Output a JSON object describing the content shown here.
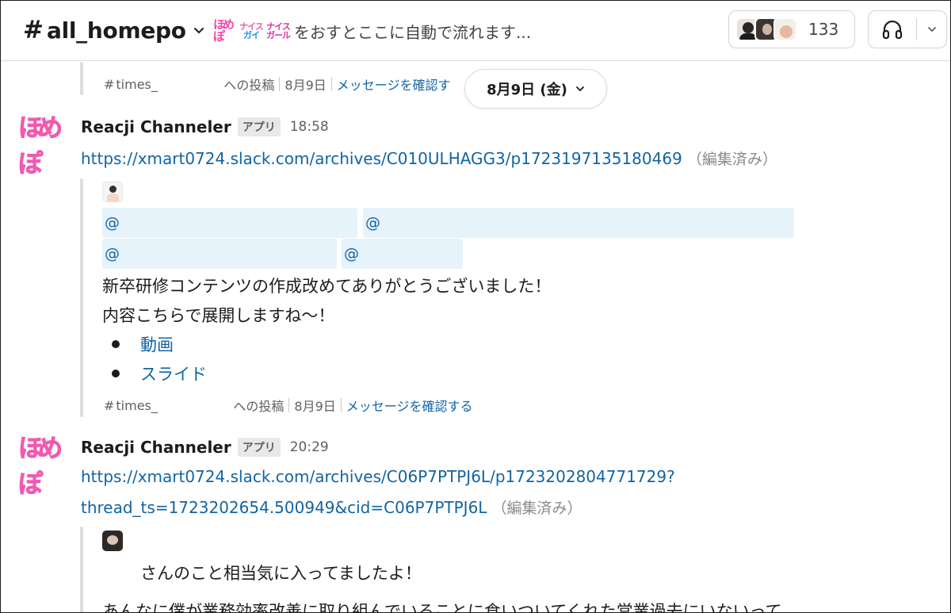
{
  "header": {
    "channel_hash": "#",
    "channel_name": "all_homepo",
    "topic_emojis": [
      "ほめぽ",
      "ナイスガイ",
      "ナイスガール"
    ],
    "topic_text": "をおすとここに自動で流れます...",
    "member_count": "133"
  },
  "date_divider": "8月9日 (金)",
  "top_context": {
    "channel": "times_",
    "post_label": "への投稿",
    "date": "8月9日",
    "view_link": "メッセージを確認す"
  },
  "messages": [
    {
      "avatar_text": "ほめぽ",
      "sender": "Reacji Channeler",
      "badge": "アプリ",
      "time": "18:58",
      "link": "https://xmart0724.slack.com/archives/C010ULHAGG3/p1723197135180469",
      "edited": "（編集済み）",
      "mentions": [
        "@",
        "@",
        "@",
        "@"
      ],
      "lines": [
        "新卒研修コンテンツの作成改めてありがとうございました！",
        "内容こちらで展開しますね〜！"
      ],
      "bullets": [
        "動画",
        "スライド"
      ],
      "context": {
        "channel": "times_",
        "post_label": "への投稿",
        "date": "8月9日",
        "view_link": "メッセージを確認する"
      }
    },
    {
      "avatar_text": "ほめぽ",
      "sender": "Reacji Channeler",
      "badge": "アプリ",
      "time": "20:29",
      "link_line1": "https://xmart0724.slack.com/archives/C06P7PTPJ6L/p1723202804771729?",
      "link_line2": "thread_ts=1723202654.500949&cid=C06P7PTPJ6L",
      "edited": "（編集済み）",
      "line1": "さんのこと相当気に入ってましたよ！",
      "line2": "あんなに僕が業務効率改善に取り組んでいることに食いついてくれた営業過去にいないって"
    }
  ]
}
